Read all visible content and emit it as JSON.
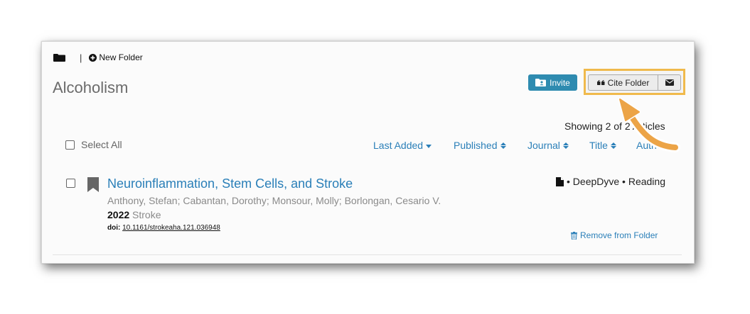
{
  "toolbar": {
    "separator": "|",
    "new_folder_label": "New Folder"
  },
  "folder": {
    "title": "Alcoholism"
  },
  "actions": {
    "invite_label": "Invite",
    "cite_folder_label": "Cite Folder"
  },
  "list": {
    "showing_text": "Showing 2 of 2 Articles",
    "select_all_label": "Select All",
    "sort_options": [
      {
        "label": "Last Added",
        "icon": "caret-down-icon"
      },
      {
        "label": "Published",
        "icon": "sort-icon"
      },
      {
        "label": "Journal",
        "icon": "sort-icon"
      },
      {
        "label": "Title",
        "icon": "sort-icon"
      },
      {
        "label": "Author",
        "icon": "sort-icon"
      }
    ]
  },
  "articles": [
    {
      "title": "Neuroinflammation, Stem Cells, and Stroke",
      "authors": "Anthony, Stefan; Cabantan, Dorothy; Monsour, Molly; Borlongan, Cesario V.",
      "year": "2022",
      "journal": "Stroke",
      "doi_label": "doi:",
      "doi": "10.1161/strokeaha.121.036948",
      "sources": "• DeepDyve • Reading",
      "remove_label": "Remove from Folder"
    }
  ],
  "colors": {
    "accent": "#2a7fb8",
    "invite_bg": "#2e8bb0",
    "highlight": "#f0ba4c",
    "arrow": "#eca447"
  }
}
